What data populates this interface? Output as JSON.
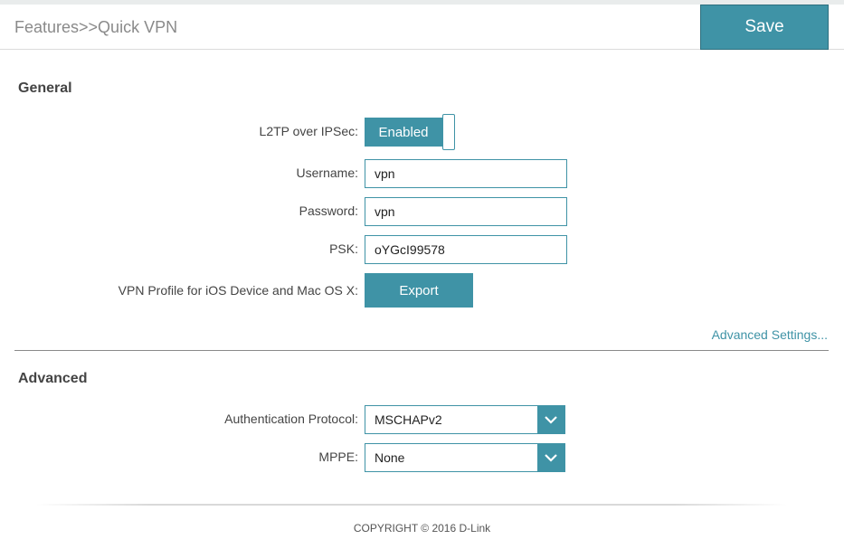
{
  "header": {
    "breadcrumb": "Features>>Quick VPN",
    "save_label": "Save"
  },
  "general": {
    "title": "General",
    "l2tp": {
      "label": "L2TP over IPSec:",
      "state_label": "Enabled"
    },
    "username": {
      "label": "Username:",
      "value": "vpn"
    },
    "password": {
      "label": "Password:",
      "value": "vpn"
    },
    "psk": {
      "label": "PSK:",
      "value": "oYGcI99578"
    },
    "vpn_profile": {
      "label": "VPN Profile for iOS Device and Mac OS X:",
      "button_label": "Export"
    },
    "advanced_link": "Advanced Settings..."
  },
  "advanced": {
    "title": "Advanced",
    "auth_protocol": {
      "label": "Authentication Protocol:",
      "selected": "MSCHAPv2"
    },
    "mppe": {
      "label": "MPPE:",
      "selected": "None"
    }
  },
  "footer": {
    "copyright": "COPYRIGHT © 2016 D-Link"
  },
  "colors": {
    "accent": "#3f93a6",
    "text": "#444444",
    "muted": "#8a8a8a"
  }
}
